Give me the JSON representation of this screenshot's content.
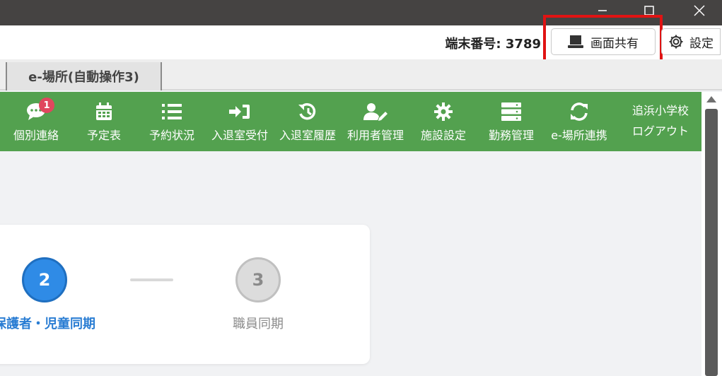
{
  "window": {
    "controls": {
      "minimize": "minimize",
      "maximize": "maximize",
      "close": "close"
    }
  },
  "header": {
    "terminal_label": "端末番号: 3789",
    "screen_share_label": "画面共有",
    "settings_label": "設定",
    "highlight_color": "#e01313"
  },
  "tabs": [
    {
      "label": "e-場所(自動操作3)"
    }
  ],
  "nav": {
    "color": "#53a14f",
    "items": [
      {
        "label": "個別連絡",
        "icon": "comment-icon",
        "badge": "1"
      },
      {
        "label": "予定表",
        "icon": "calendar-icon"
      },
      {
        "label": "予約状況",
        "icon": "list-icon"
      },
      {
        "label": "入退室受付",
        "icon": "sign-in-icon"
      },
      {
        "label": "入退室履歴",
        "icon": "history-icon"
      },
      {
        "label": "利用者管理",
        "icon": "user-edit-icon"
      },
      {
        "label": "施設設定",
        "icon": "gear-icon"
      },
      {
        "label": "勤務管理",
        "icon": "server-icon"
      },
      {
        "label": "e-場所連携",
        "icon": "sync-icon"
      }
    ],
    "school_name": "追浜小学校",
    "logout_label": "ログアウト"
  },
  "steps": [
    {
      "number": "2",
      "label": "保護者・児童同期",
      "state": "active"
    },
    {
      "number": "3",
      "label": "職員同期",
      "state": "inactive"
    }
  ]
}
